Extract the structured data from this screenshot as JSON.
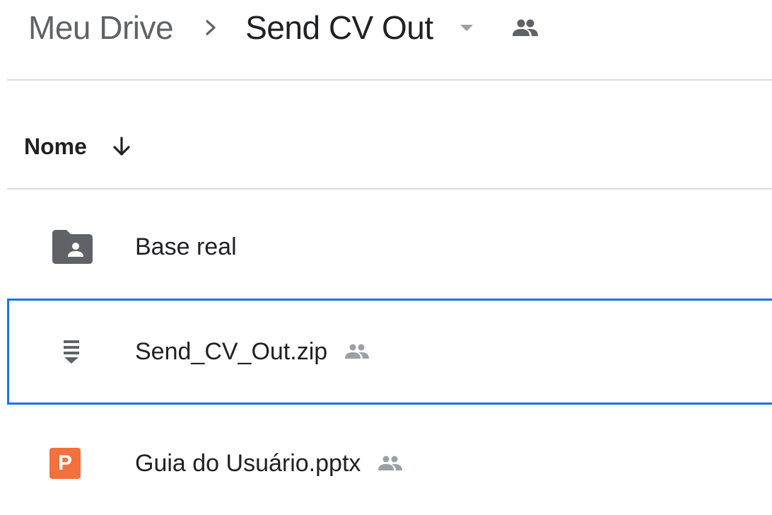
{
  "breadcrumb": {
    "root": "Meu Drive",
    "current": "Send CV Out",
    "separator_icon": "chevron-right-icon",
    "dropdown_icon": "caret-down-icon",
    "shared_icon": "people-icon"
  },
  "list_header": {
    "column_label": "Nome",
    "sort_icon": "arrow-down-icon",
    "sort_direction": "descending"
  },
  "files": [
    {
      "name": "Base real",
      "type": "shared-folder",
      "icon": "shared-folder-icon",
      "shared": false,
      "selected": false
    },
    {
      "name": "Send_CV_Out.zip",
      "type": "zip",
      "icon": "zip-file-icon",
      "shared": true,
      "selected": true
    },
    {
      "name": "Guia do Usuário.pptx",
      "type": "powerpoint",
      "icon": "powerpoint-file-icon",
      "icon_letter": "P",
      "shared": true,
      "selected": false
    }
  ],
  "colors": {
    "selection_border": "#1a73e8",
    "folder_icon": "#5f6368",
    "ppt_badge": "#f4703c",
    "divider": "#dadce0",
    "muted_icon": "#9aa0a6"
  }
}
